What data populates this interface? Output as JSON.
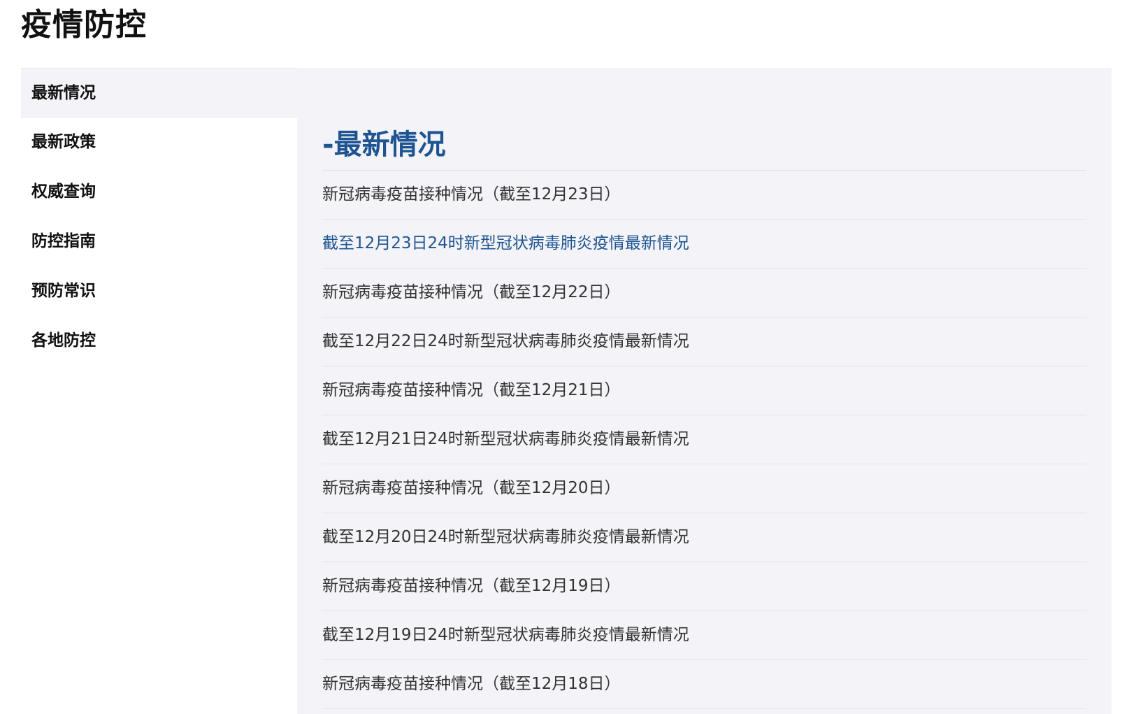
{
  "page": {
    "title": "疫情防控"
  },
  "sidebar": {
    "items": [
      {
        "label": "最新情况",
        "active": true
      },
      {
        "label": "最新政策",
        "active": false
      },
      {
        "label": "权威查询",
        "active": false
      },
      {
        "label": "防控指南",
        "active": false
      },
      {
        "label": "预防常识",
        "active": false
      },
      {
        "label": "各地防控",
        "active": false
      }
    ]
  },
  "main": {
    "heading": "-最新情况",
    "articles": [
      {
        "title": "新冠病毒疫苗接种情况（截至12月23日）",
        "highlighted": false
      },
      {
        "title": "截至12月23日24时新型冠状病毒肺炎疫情最新情况",
        "highlighted": true
      },
      {
        "title": "新冠病毒疫苗接种情况（截至12月22日）",
        "highlighted": false
      },
      {
        "title": "截至12月22日24时新型冠状病毒肺炎疫情最新情况",
        "highlighted": false
      },
      {
        "title": "新冠病毒疫苗接种情况（截至12月21日）",
        "highlighted": false
      },
      {
        "title": "截至12月21日24时新型冠状病毒肺炎疫情最新情况",
        "highlighted": false
      },
      {
        "title": "新冠病毒疫苗接种情况（截至12月20日）",
        "highlighted": false
      },
      {
        "title": "截至12月20日24时新型冠状病毒肺炎疫情最新情况",
        "highlighted": false
      },
      {
        "title": "新冠病毒疫苗接种情况（截至12月19日）",
        "highlighted": false
      },
      {
        "title": "截至12月19日24时新型冠状病毒肺炎疫情最新情况",
        "highlighted": false
      },
      {
        "title": "新冠病毒疫苗接种情况（截至12月18日）",
        "highlighted": false
      }
    ]
  },
  "colors": {
    "accent": "#1e5591",
    "panel_background": "#f3f3f8",
    "text": "#333333"
  }
}
